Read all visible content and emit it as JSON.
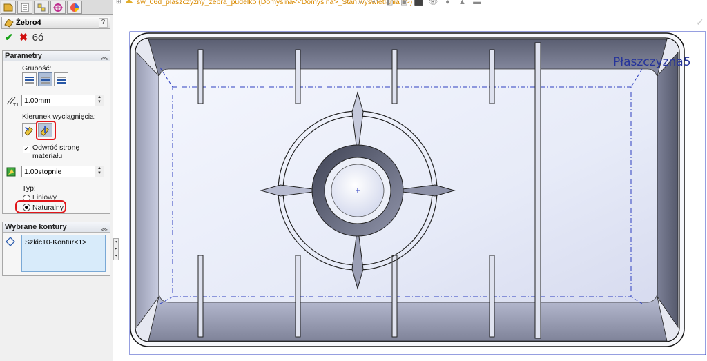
{
  "manager_tabs": [
    "feature-manager-tab",
    "property-manager-tab",
    "configuration-manager-tab",
    "dimxpert-manager-tab",
    "display-manager-tab"
  ],
  "feature": {
    "title": "Żebro4",
    "help": "?"
  },
  "actions": {
    "ok": "✔",
    "cancel": "✖",
    "preview": "6ó"
  },
  "params": {
    "header": "Parametry",
    "thickness_label": "Grubość:",
    "thickness_value": "1.00mm",
    "direction_label": "Kierunek wyciągnięcia:",
    "flip_label_1": "Odwróć stronę",
    "flip_label_2": "materiału",
    "flip_checked": "✓",
    "draft_value": "1.00stopnie",
    "type_label": "Typ:",
    "type_linear": "Liniowy",
    "type_natural": "Naturalny"
  },
  "contours": {
    "header": "Wybrane kontury",
    "item": "Szkic10-Kontur<1>"
  },
  "breadcrumb": "sw_06d_plaszczyzny_zebra_pudelko  (Domyślna<<Domyślna>_Stan wyświetlania 1>)",
  "viewport": {
    "plane_label": "Płaszczyzna5"
  },
  "colors": {
    "accent_red": "#e0161a",
    "sketch_blue": "#2e3fc0",
    "breadcrumb_orange": "#d98a00"
  }
}
